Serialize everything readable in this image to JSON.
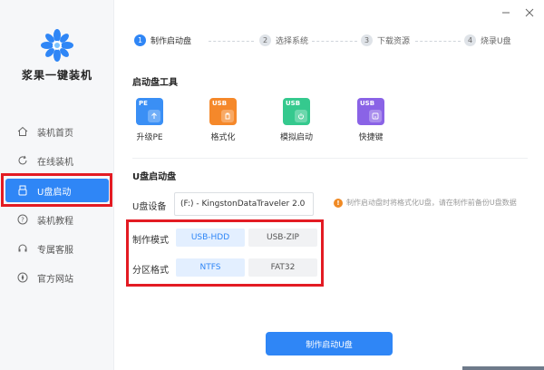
{
  "brand": {
    "name": "浆果一键装机"
  },
  "sidebar": {
    "items": [
      {
        "label": "装机首页",
        "icon": "home-icon"
      },
      {
        "label": "在线装机",
        "icon": "refresh-icon"
      },
      {
        "label": "U盘启动",
        "icon": "usb-icon",
        "active": true
      },
      {
        "label": "装机教程",
        "icon": "help-icon"
      },
      {
        "label": "专属客服",
        "icon": "headset-icon"
      },
      {
        "label": "官方网站",
        "icon": "compass-icon"
      }
    ]
  },
  "steps": [
    {
      "num": "1",
      "label": "制作启动盘",
      "active": true
    },
    {
      "num": "2",
      "label": "选择系统"
    },
    {
      "num": "3",
      "label": "下载资源"
    },
    {
      "num": "4",
      "label": "烧录U盘"
    }
  ],
  "tools_section": {
    "title": "启动盘工具"
  },
  "tools": [
    {
      "badge": "PE",
      "label": "升级PE",
      "color": "#3a8ff5"
    },
    {
      "badge": "USB",
      "label": "格式化",
      "color": "#f5882a"
    },
    {
      "badge": "USB",
      "label": "模拟启动",
      "color": "#35c98e"
    },
    {
      "badge": "USB",
      "label": "快捷键",
      "color": "#8a63e6"
    }
  ],
  "usb_section": {
    "title": "U盘启动盘"
  },
  "device": {
    "label": "U盘设备",
    "value": "(F:) - KingstonDataTraveler 2.0",
    "warning": "制作启动盘时将格式化U盘，请在制作前备份U盘数据"
  },
  "mode": {
    "label": "制作模式",
    "options": [
      "USB-HDD",
      "USB-ZIP"
    ],
    "selected": "USB-HDD"
  },
  "partition": {
    "label": "分区格式",
    "options": [
      "NTFS",
      "FAT32"
    ],
    "selected": "NTFS"
  },
  "action": {
    "label": "制作启动U盘"
  },
  "colors": {
    "accent": "#2f86f6",
    "highlight": "#e31b23"
  }
}
